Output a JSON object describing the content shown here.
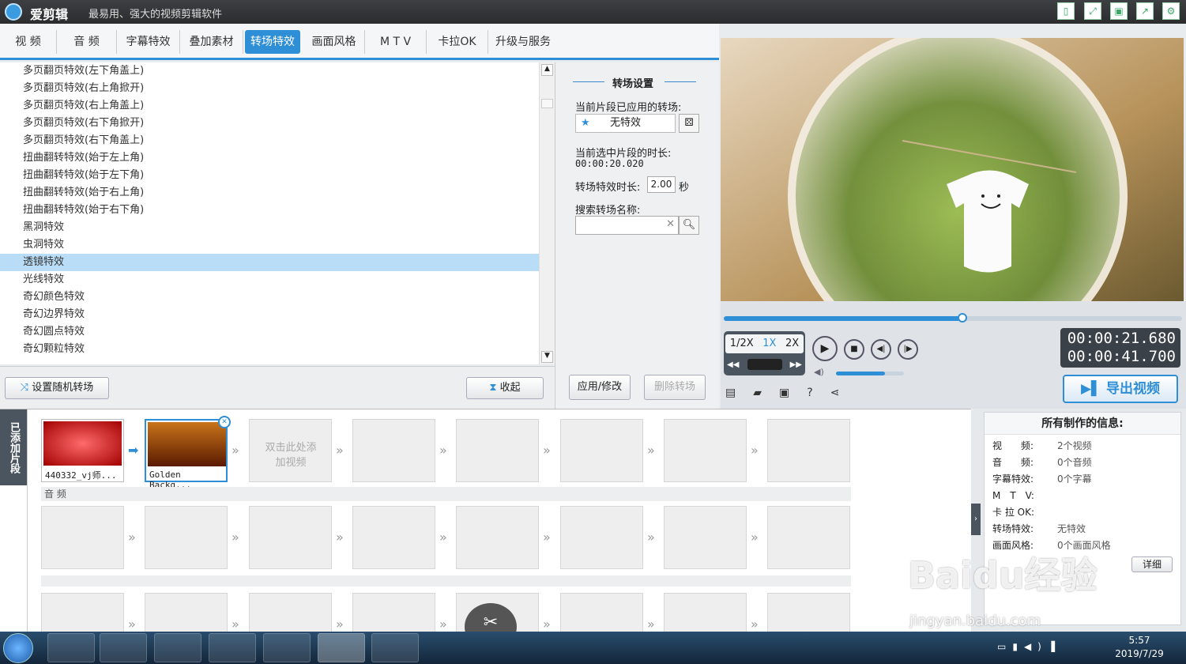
{
  "titlebar": {
    "app_name": "爱剪辑",
    "slogan": "最易用、强大的视频剪辑软件"
  },
  "tabs": [
    "视 频",
    "音 频",
    "字幕特效",
    "叠加素材",
    "转场特效",
    "画面风格",
    "M T V",
    "卡拉OK",
    "升级与服务"
  ],
  "active_tab": "转场特效",
  "effect_list": [
    "多页翻页特效(左下角盖上)",
    "多页翻页特效(右上角掀开)",
    "多页翻页特效(右上角盖上)",
    "多页翻页特效(右下角掀开)",
    "多页翻页特效(右下角盖上)",
    "扭曲翻转特效(始于左上角)",
    "扭曲翻转特效(始于左下角)",
    "扭曲翻转特效(始于右上角)",
    "扭曲翻转特效(始于右下角)",
    "黑洞特效",
    "虫洞特效",
    "透镜特效",
    "光线特效",
    "奇幻颜色特效",
    "奇幻边界特效",
    "奇幻圆点特效",
    "奇幻颗粒特效"
  ],
  "selected_effect_index": 11,
  "list_buttons": {
    "random": "设置随机转场",
    "collapse": "收起"
  },
  "settings": {
    "header": "转场设置",
    "applied_label": "当前片段已应用的转场:",
    "applied_value": "无特效",
    "duration_label": "当前选中片段的时长:",
    "duration_value": "00:00:20.020",
    "effect_duration_label": "转场特效时长:",
    "effect_duration_value": "2.00",
    "seconds": "秒",
    "search_label": "搜索转场名称:",
    "search_value": "",
    "apply": "应用/修改",
    "delete": "删除转场"
  },
  "player": {
    "speeds": [
      "1/2X",
      "1X",
      "2X"
    ],
    "active_speed": "1X",
    "time_current": "00:00:21.680",
    "time_total": "00:00:41.700",
    "export": "导出视频",
    "progress": 0.52,
    "volume": 0.72
  },
  "timeline": {
    "side_label": "已添加片段",
    "clips": [
      {
        "name": "440332_vj师..."
      },
      {
        "name": "Golden Backg..."
      }
    ],
    "add_hint": "双击此处添加视频",
    "audio_label": "音 频"
  },
  "info": {
    "title": "所有制作的信息:",
    "rows": [
      [
        "视　　频:",
        "2个视频"
      ],
      [
        "音　　频:",
        "0个音频"
      ],
      [
        "字幕特效:",
        "0个字幕"
      ],
      [
        "M　T　V:",
        ""
      ],
      [
        "卡 拉 OK:",
        ""
      ],
      [
        "转场特效:",
        "无特效"
      ],
      [
        "画面风格:",
        "0个画面风格"
      ]
    ],
    "detail": "详细"
  },
  "taskbar": {
    "time": "5:57",
    "date": "2019/7/29"
  },
  "watermark": {
    "brand": "Baidu经验",
    "url": "jingyan.baidu.com"
  }
}
